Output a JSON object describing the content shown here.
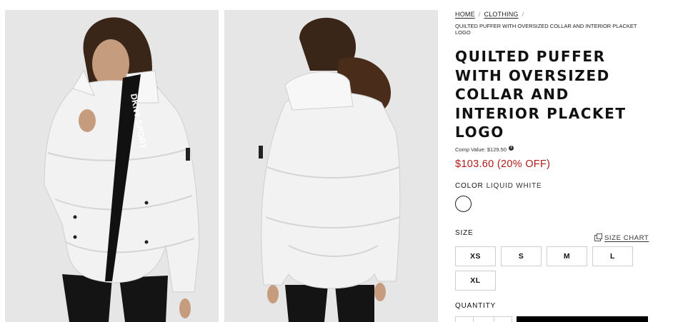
{
  "breadcrumb": {
    "home": "HOME",
    "category": "CLOTHING",
    "current": "QUILTED PUFFER WITH OVERSIZED COLLAR AND INTERIOR PLACKET LOGO"
  },
  "images": {
    "front_logo_text": "DKNY SPORT",
    "front_alt": "front-view",
    "back_alt": "back-view"
  },
  "product": {
    "title": "QUILTED PUFFER WITH OVERSIZED COLLAR AND INTERIOR PLACKET LOGO",
    "comp_value": "Comp Value: $129.50",
    "price": "$103.60 (20% OFF)",
    "price_color": "#b01a1a"
  },
  "color": {
    "label": "COLOR",
    "value": "LIQUID WHITE",
    "swatch_color": "#ffffff"
  },
  "size": {
    "label": "SIZE",
    "chart_link": "SIZE CHART",
    "options": [
      "XS",
      "S",
      "M",
      "L",
      "XL"
    ]
  },
  "quantity": {
    "label": "QUANTITY"
  },
  "icons": {
    "info": "info-icon",
    "size_chart": "size-chart-icon"
  }
}
